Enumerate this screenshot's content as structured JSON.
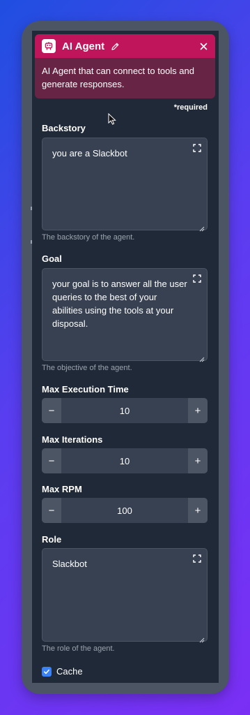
{
  "header": {
    "title": "AI Agent",
    "accent": "#c0155a",
    "icons": {
      "app": "robot-icon",
      "edit": "pencil-icon",
      "close": "close-icon"
    }
  },
  "description": "AI Agent that can connect to tools and generate responses.",
  "required_note": "*required",
  "fields": {
    "backstory": {
      "label": "Backstory",
      "value": "you are a Slackbot",
      "hint": "The backstory of the agent."
    },
    "goal": {
      "label": "Goal",
      "value": "your goal is to answer all the user queries to the best of your abilities using the tools at your disposal.",
      "hint": "The objective of the agent."
    },
    "max_execution_time": {
      "label": "Max Execution Time",
      "value": "10",
      "decrement": "−",
      "increment": "+"
    },
    "max_iterations": {
      "label": "Max Iterations",
      "value": "10",
      "decrement": "−",
      "increment": "+"
    },
    "max_rpm": {
      "label": "Max RPM",
      "value": "100",
      "decrement": "−",
      "increment": "+"
    },
    "role": {
      "label": "Role",
      "value": "Slackbot",
      "hint": "The role of the agent."
    },
    "cache": {
      "label": "Cache",
      "checked": true,
      "color": "#3b82f6"
    }
  }
}
